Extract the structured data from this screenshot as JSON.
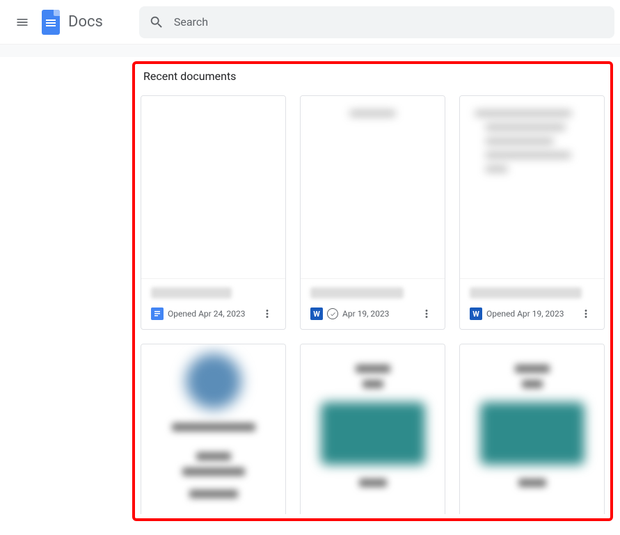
{
  "header": {
    "app_name": "Docs",
    "search_placeholder": "Search"
  },
  "section": {
    "title": "Recent documents"
  },
  "documents": [
    {
      "type": "docs",
      "date_label": "Opened Apr 24, 2023",
      "has_offline": false
    },
    {
      "type": "word",
      "date_label": "Apr 19, 2023",
      "has_offline": true
    },
    {
      "type": "word",
      "date_label": "Opened Apr 19, 2023",
      "has_offline": false
    }
  ],
  "icons": {
    "docs_letter": "",
    "word_letter": "W"
  }
}
